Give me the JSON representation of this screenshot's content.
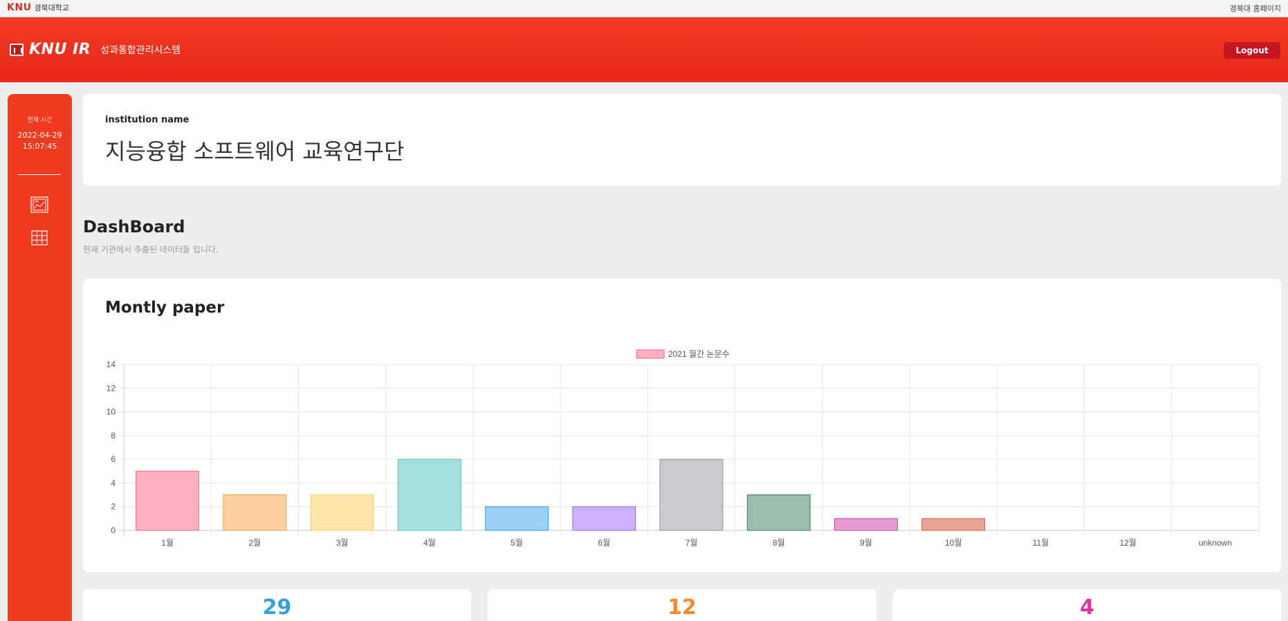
{
  "topbar": {
    "brand": "KNU",
    "university": "경북대학교",
    "home_link": "경북대 홈페이지"
  },
  "header": {
    "logo": "KNU IR",
    "system_title": "성과통합관리시스템",
    "logout": "Logout"
  },
  "sidebar": {
    "clock_label": "현재 시간",
    "date": "2022-04-29",
    "time": "15:07:45",
    "nav": [
      {
        "icon": "dashboard-chart-icon"
      },
      {
        "icon": "table-grid-icon"
      }
    ]
  },
  "institution": {
    "label": "institution name",
    "name": "지능융합 소프트웨어 교육연구단"
  },
  "dashboard": {
    "title": "DashBoard",
    "subtitle": "현재 기관에서 추출된 데이터들 입니다."
  },
  "monthly": {
    "title": "Montly paper"
  },
  "stats": [
    {
      "value": "29",
      "color": "#3a9fe0"
    },
    {
      "value": "12",
      "color": "#f28b30"
    },
    {
      "value": "4",
      "color": "#d63aa0"
    }
  ],
  "chart_data": {
    "type": "bar",
    "categories": [
      "1월",
      "2월",
      "3월",
      "4월",
      "5월",
      "6월",
      "7월",
      "8월",
      "9월",
      "10월",
      "11월",
      "12월",
      "unknown"
    ],
    "series": [
      {
        "name": "2021 월간 논문수",
        "values": [
          5,
          3,
          3,
          6,
          2,
          2,
          6,
          3,
          1,
          1,
          0,
          0,
          0
        ]
      }
    ],
    "ylim": [
      0,
      14
    ],
    "yticks": [
      0,
      2,
      4,
      6,
      8,
      10,
      12,
      14
    ],
    "grid": true,
    "legend": "top-center",
    "colors": [
      {
        "fill": "#ffb1c1",
        "stroke": "#ff6384"
      },
      {
        "fill": "#ffcf9f",
        "stroke": "#ff9f40"
      },
      {
        "fill": "#ffe6aa",
        "stroke": "#ffcd56"
      },
      {
        "fill": "#a5dfdf",
        "stroke": "#4bc0c0"
      },
      {
        "fill": "#9ad0f5",
        "stroke": "#36a2eb"
      },
      {
        "fill": "#ccb2ff",
        "stroke": "#9966ff"
      },
      {
        "fill": "#c9cbcf",
        "stroke": "#909396"
      },
      {
        "fill": "#9dbcae",
        "stroke": "#3b7a5e"
      },
      {
        "fill": "#e89ad3",
        "stroke": "#c645a6"
      },
      {
        "fill": "#e8a595",
        "stroke": "#d35a3f"
      },
      {
        "fill": "#cccccc",
        "stroke": "#999999"
      },
      {
        "fill": "#cccccc",
        "stroke": "#999999"
      },
      {
        "fill": "#cccccc",
        "stroke": "#999999"
      }
    ],
    "legend_color": {
      "fill": "#ffb1c1",
      "stroke": "#ff6384"
    }
  }
}
